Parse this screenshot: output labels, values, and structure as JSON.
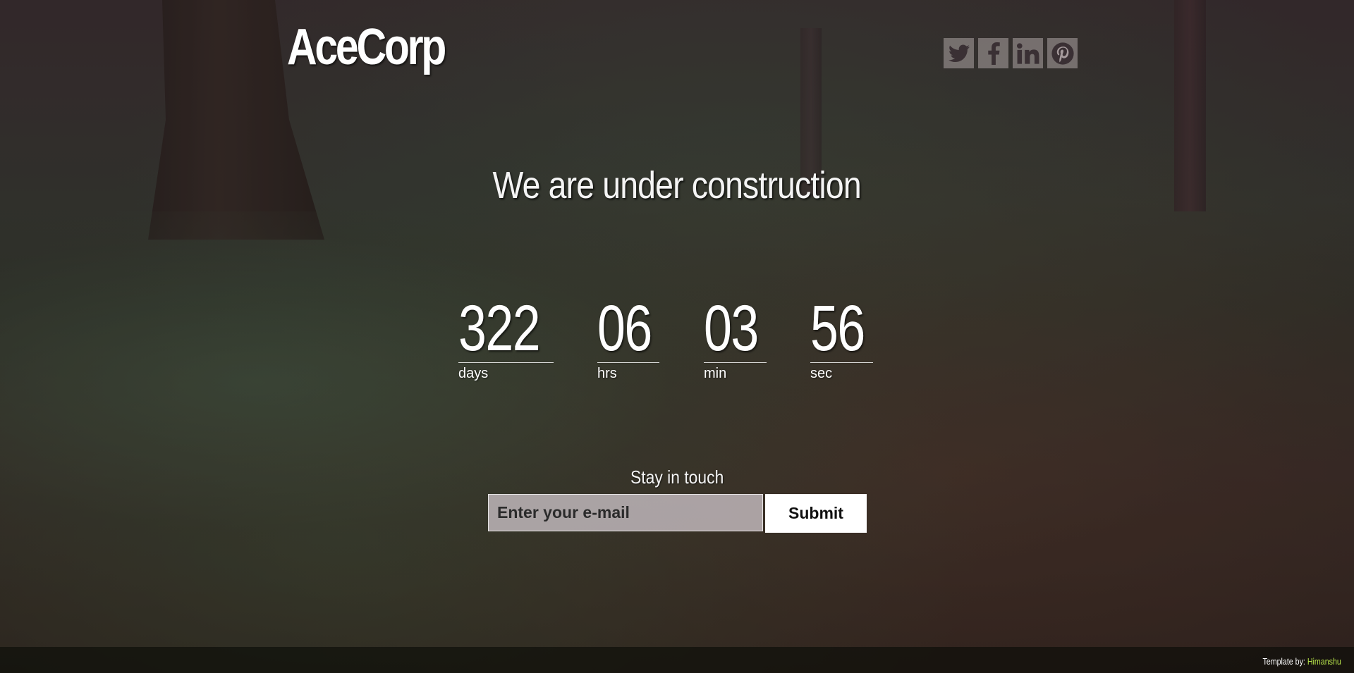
{
  "brand": {
    "logo_text": "AceCorp"
  },
  "social": [
    {
      "name": "twitter-icon"
    },
    {
      "name": "facebook-icon"
    },
    {
      "name": "linkedin-icon"
    },
    {
      "name": "pinterest-icon"
    }
  ],
  "hero": {
    "headline": "We are under construction"
  },
  "countdown": {
    "days": {
      "value": "322",
      "label": "days"
    },
    "hrs": {
      "value": "06",
      "label": "hrs"
    },
    "min": {
      "value": "03",
      "label": "min"
    },
    "sec": {
      "value": "56",
      "label": "sec"
    }
  },
  "subscribe": {
    "heading": "Stay in touch",
    "email_placeholder": "Enter your e-mail",
    "submit_label": "Submit"
  },
  "footer": {
    "credit_prefix": "Template by:",
    "credit_author": "Himanshu",
    "author_color": "#b7e34a"
  }
}
